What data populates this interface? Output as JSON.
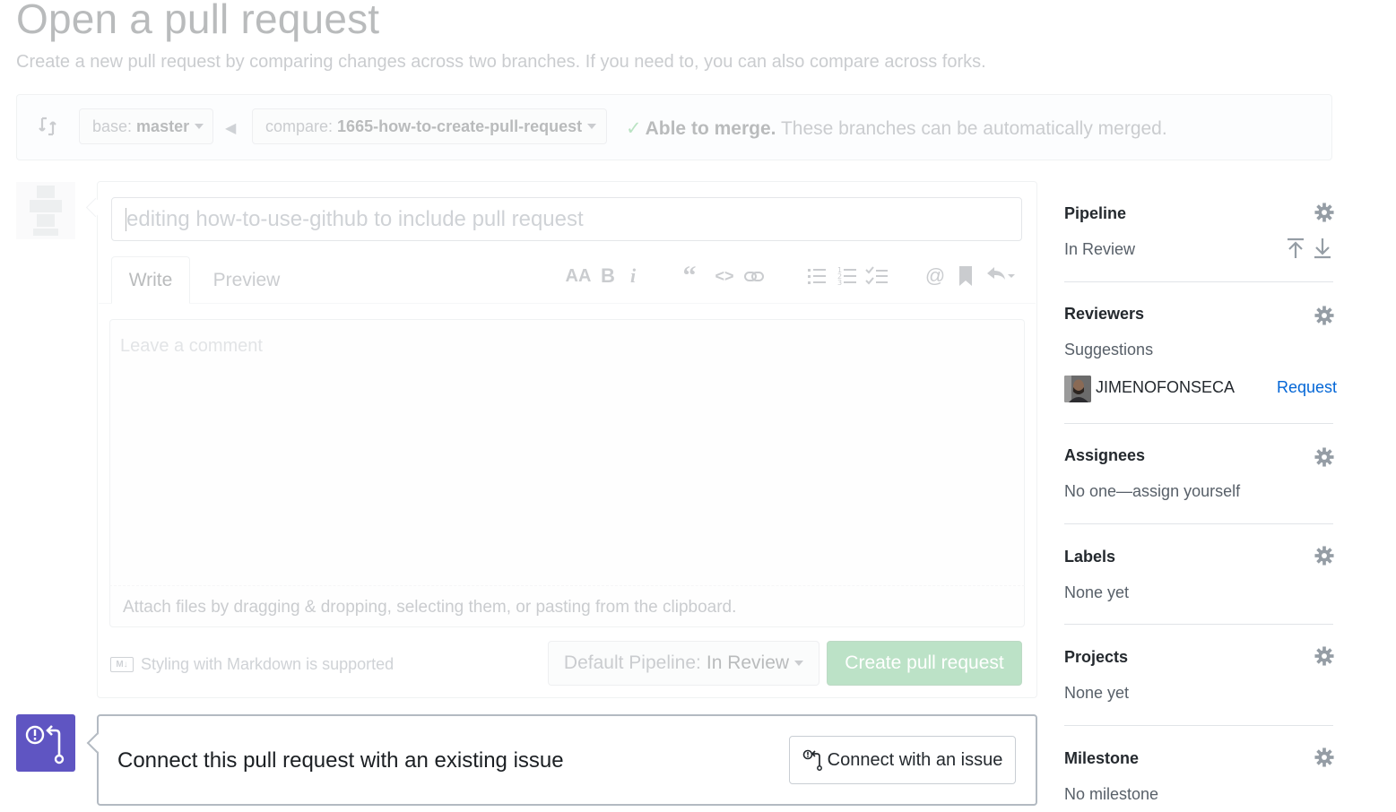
{
  "header": {
    "title": "Open a pull request",
    "subtitle": "Create a new pull request by comparing changes across two branches. If you need to, you can also compare across forks."
  },
  "range": {
    "base_prefix": "base:",
    "base_branch": "master",
    "compare_prefix": "compare:",
    "compare_branch": "1665-how-to-create-pull-request",
    "merge_status": "Able to merge.",
    "merge_note": "These branches can be automatically merged."
  },
  "form": {
    "title_value": "editing how-to-use-github to include pull request",
    "tabs": [
      {
        "label": "Write"
      },
      {
        "label": "Preview"
      }
    ],
    "comment_placeholder": "Leave a comment",
    "attach_text": "Attach files by dragging & dropping, selecting them, or pasting from the clipboard.",
    "markdown_badge": "M↓",
    "markdown_note": "Styling with Markdown is supported",
    "pipeline_prefix": "Default Pipeline:",
    "pipeline_value": "In Review",
    "create_label": "Create pull request"
  },
  "issue": {
    "text": "Connect this pull request with an existing issue",
    "button_label": "Connect with an issue"
  },
  "sidebar": {
    "pipeline": {
      "heading": "Pipeline",
      "value": "In Review"
    },
    "reviewers": {
      "heading": "Reviewers",
      "suggestions": "Suggestions",
      "user": "JIMENOFONSECA",
      "request": "Request"
    },
    "assignees": {
      "heading": "Assignees",
      "value": "No one—assign yourself"
    },
    "labels": {
      "heading": "Labels",
      "value": "None yet"
    },
    "projects": {
      "heading": "Projects",
      "value": "None yet"
    },
    "milestone": {
      "heading": "Milestone",
      "value": "No milestone"
    }
  },
  "colors": {
    "accent_blue": "#0366d6",
    "merge_green": "#28a745",
    "create_green": "#2ea44f",
    "issue_purple": "#5f55c2"
  },
  "icons": [
    "compare-icon",
    "arrow-left-icon",
    "check-icon",
    "text-size-icon",
    "bold-icon",
    "italic-icon",
    "quote-icon",
    "code-icon",
    "link-icon",
    "unordered-list-icon",
    "ordered-list-icon",
    "task-list-icon",
    "mention-icon",
    "bookmark-icon",
    "reply-icon",
    "gear-icon",
    "move-top-icon",
    "move-bottom-icon",
    "issue-connect-icon"
  ]
}
